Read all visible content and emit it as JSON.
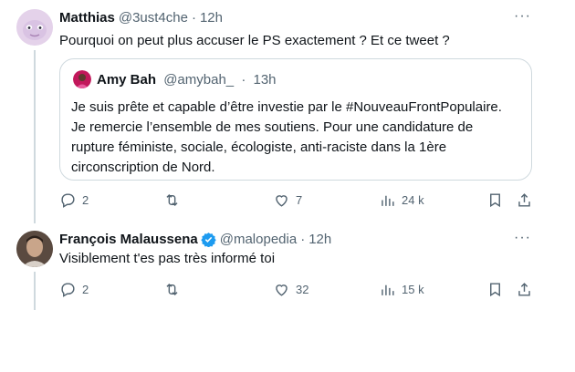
{
  "tweets": [
    {
      "name": "Matthias",
      "handle": "@3ust4che",
      "time": "12h",
      "text": "Pourquoi on peut plus accuser le PS exactement ? Et ce tweet ?",
      "quote": {
        "name": "Amy Bah",
        "handle": "@amybah_",
        "time": "13h",
        "lines": [
          "Je suis prête et capable d’être investie par le #NouveauFrontPopulaire.",
          "Je remercie l’ensemble de mes soutiens. Pour une candidature de",
          "rupture féministe, sociale, écologiste, anti-raciste dans la 1ère",
          "circonscription de Nord."
        ]
      },
      "stats": {
        "replies": "2",
        "reposts": "",
        "likes": "7",
        "views": "24 k"
      }
    },
    {
      "name": "François Malaussena",
      "handle": "@malopedia",
      "time": "12h",
      "verified": true,
      "text": "Visiblement t'es pas très informé toi",
      "stats": {
        "replies": "2",
        "reposts": "",
        "likes": "32",
        "views": "15 k"
      }
    }
  ],
  "colors": {
    "accent": "#1d9bf0",
    "muted": "#536471",
    "border": "#cfd9de"
  },
  "dot": "·",
  "more": "···"
}
